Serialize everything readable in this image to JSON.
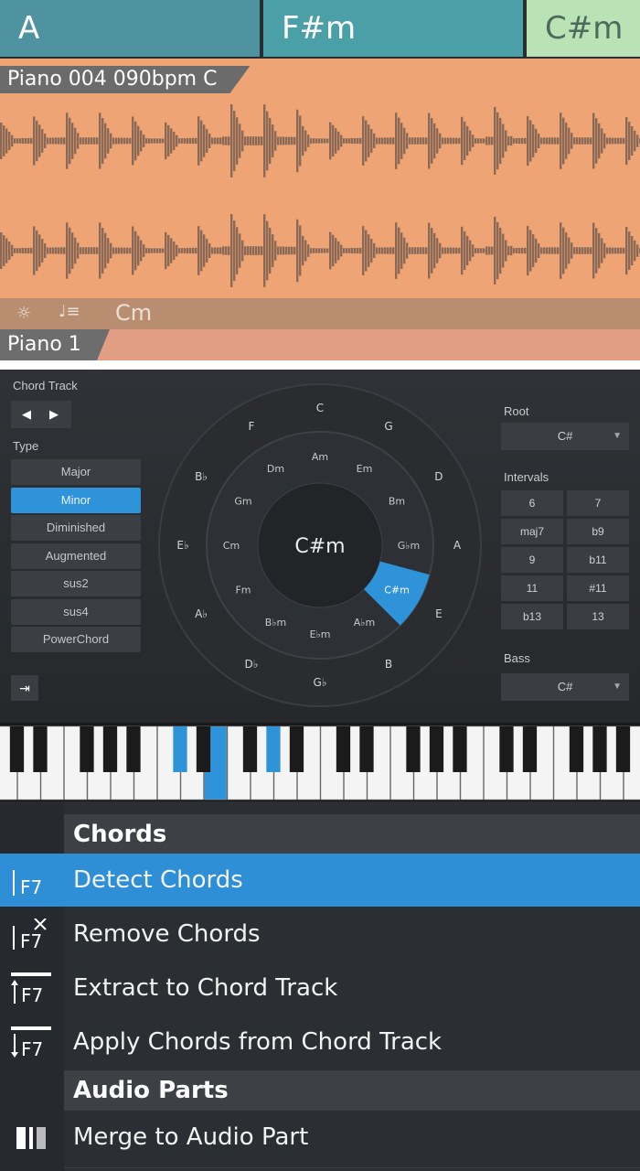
{
  "chord_bar": {
    "chords": [
      {
        "label": "A",
        "color": "#4f93a1"
      },
      {
        "label": "F#m",
        "color": "#4aa0a6"
      },
      {
        "label": "C#m",
        "color": "#b9e3b5"
      }
    ]
  },
  "audio_event": {
    "title": "Piano 004 090bpm C",
    "footer_chord": "Cm",
    "track_name": "Piano 1",
    "colors": {
      "event": "#eea474",
      "waveform": "#8a6a57"
    }
  },
  "chord_selector": {
    "header": "Chord Track",
    "type_label": "Type",
    "types": [
      "Major",
      "Minor",
      "Diminished",
      "Augmented",
      "sus2",
      "sus4",
      "PowerChord"
    ],
    "selected_type": "Minor",
    "center_chord": "C#m",
    "outer_ring": [
      "C",
      "G",
      "D",
      "A",
      "E",
      "B",
      "G♭",
      "D♭",
      "A♭",
      "E♭",
      "B♭",
      "F"
    ],
    "inner_ring": [
      "Am",
      "Em",
      "Bm",
      "G♭m",
      "C#m",
      "A♭m",
      "E♭m",
      "B♭m",
      "Fm",
      "Cm",
      "Gm",
      "Dm"
    ],
    "selected_inner": "C#m",
    "root_label": "Root",
    "root_value": "C#",
    "intervals_label": "Intervals",
    "intervals": [
      "6",
      "7",
      "maj7",
      "b9",
      "9",
      "b11",
      "11",
      "#11",
      "b13",
      "13"
    ],
    "bass_label": "Bass",
    "bass_value": "C#",
    "accent": "#2e93d8"
  },
  "keyboard": {
    "highlight_color": "#2e93d8"
  },
  "menu": {
    "sections": [
      {
        "title": "Chords"
      },
      {
        "title": "Audio Parts"
      }
    ],
    "items": [
      {
        "label": "Detect Chords",
        "icon": "F7"
      },
      {
        "label": "Remove Chords",
        "icon": "F7"
      },
      {
        "label": "Extract to Chord Track",
        "icon": "F7"
      },
      {
        "label": "Apply Chords from Chord Track",
        "icon": "F7"
      },
      {
        "label": "Merge to Audio Part",
        "icon": "merge-icon"
      }
    ],
    "active_item": "Detect Chords"
  }
}
